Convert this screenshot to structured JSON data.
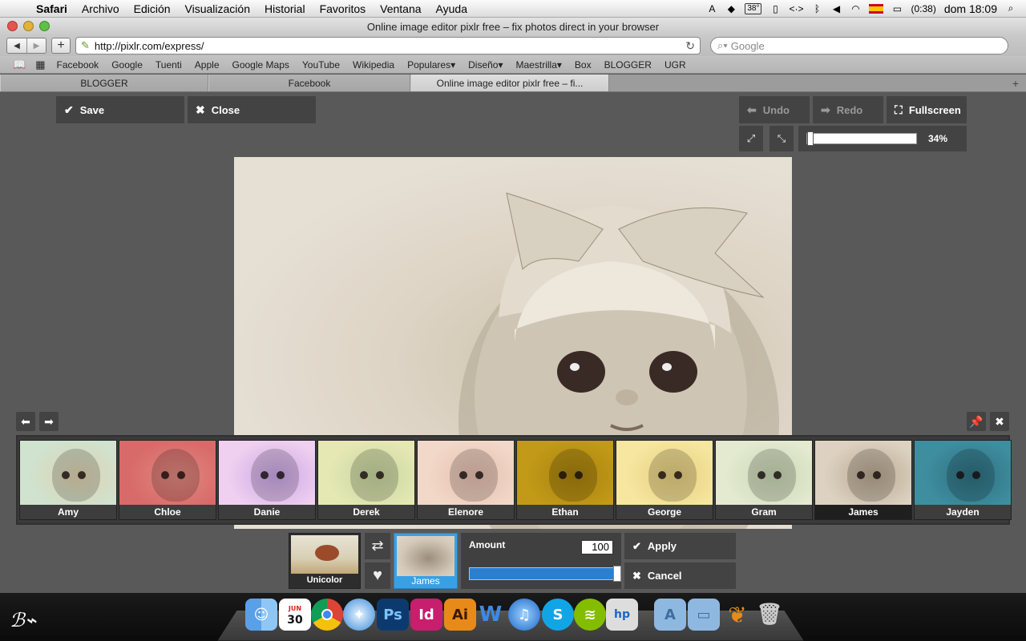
{
  "menubar": {
    "app": "Safari",
    "items": [
      "Archivo",
      "Edición",
      "Visualización",
      "Historial",
      "Favoritos",
      "Ventana",
      "Ayuda"
    ],
    "status": {
      "temperature": "38°",
      "battery": "(0:38)",
      "clock": "dom 18:09"
    }
  },
  "window": {
    "title": "Online image editor pixlr free – fix photos direct in your browser"
  },
  "toolbar": {
    "url": "http://pixlr.com/express/",
    "search_placeholder": "Google"
  },
  "bookmarks": [
    "Facebook",
    "Google",
    "Tuenti",
    "Apple",
    "Google Maps",
    "YouTube",
    "Wikipedia",
    "Populares▾",
    "Diseño▾",
    "Maestrilla▾",
    "Box",
    "BLOGGER",
    "UGR"
  ],
  "tabs": [
    {
      "label": "BLOGGER",
      "active": false
    },
    {
      "label": "Facebook",
      "active": false
    },
    {
      "label": "Online image editor pixlr free – fi...",
      "active": true
    }
  ],
  "editor": {
    "save_label": "Save",
    "close_label": "Close",
    "undo_label": "Undo",
    "redo_label": "Redo",
    "fullscreen_label": "Fullscreen",
    "zoom": "34%",
    "zoom_fraction": 0.0
  },
  "effects": [
    {
      "name": "Amy",
      "color": "#cfe3cf",
      "tint": "#e0d2b0"
    },
    {
      "name": "Chloe",
      "color": "#d86a6a",
      "tint": "#e08a80"
    },
    {
      "name": "Danie",
      "color": "#f0d0f0",
      "tint": "#c9a6e6"
    },
    {
      "name": "Derek",
      "color": "#e6e8b4",
      "tint": "#c6d6a0"
    },
    {
      "name": "Elenore",
      "color": "#f2d8c8",
      "tint": "#e6c0b0"
    },
    {
      "name": "Ethan",
      "color": "#c29a18",
      "tint": "#a8820e"
    },
    {
      "name": "George",
      "color": "#f6e6a0",
      "tint": "#e8d080"
    },
    {
      "name": "Gram",
      "color": "#e4ead0",
      "tint": "#c8d8b4"
    },
    {
      "name": "James",
      "color": "#ddd2c2",
      "tint": "#b8a890"
    },
    {
      "name": "Jayden",
      "color": "#3f8ea0",
      "tint": "#2f7080"
    }
  ],
  "selected_effect": "James",
  "panel": {
    "category_label": "Unicolor",
    "selected_label": "James",
    "amount_label": "Amount",
    "amount_value": "100",
    "apply_label": "Apply",
    "cancel_label": "Cancel"
  },
  "dock": {
    "icons": [
      "finder-icon",
      "ical-icon",
      "chrome-icon",
      "safari-icon",
      "photoshop-icon",
      "indesign-icon",
      "illustrator-icon",
      "dreamweaver-icon",
      "itunes-icon",
      "skype-icon",
      "spotify-icon",
      "preview-icon",
      "applications-folder-icon",
      "documents-folder-icon",
      "transmit-icon",
      "trash-icon"
    ],
    "ical_day": "30",
    "ical_month": "JUN"
  }
}
